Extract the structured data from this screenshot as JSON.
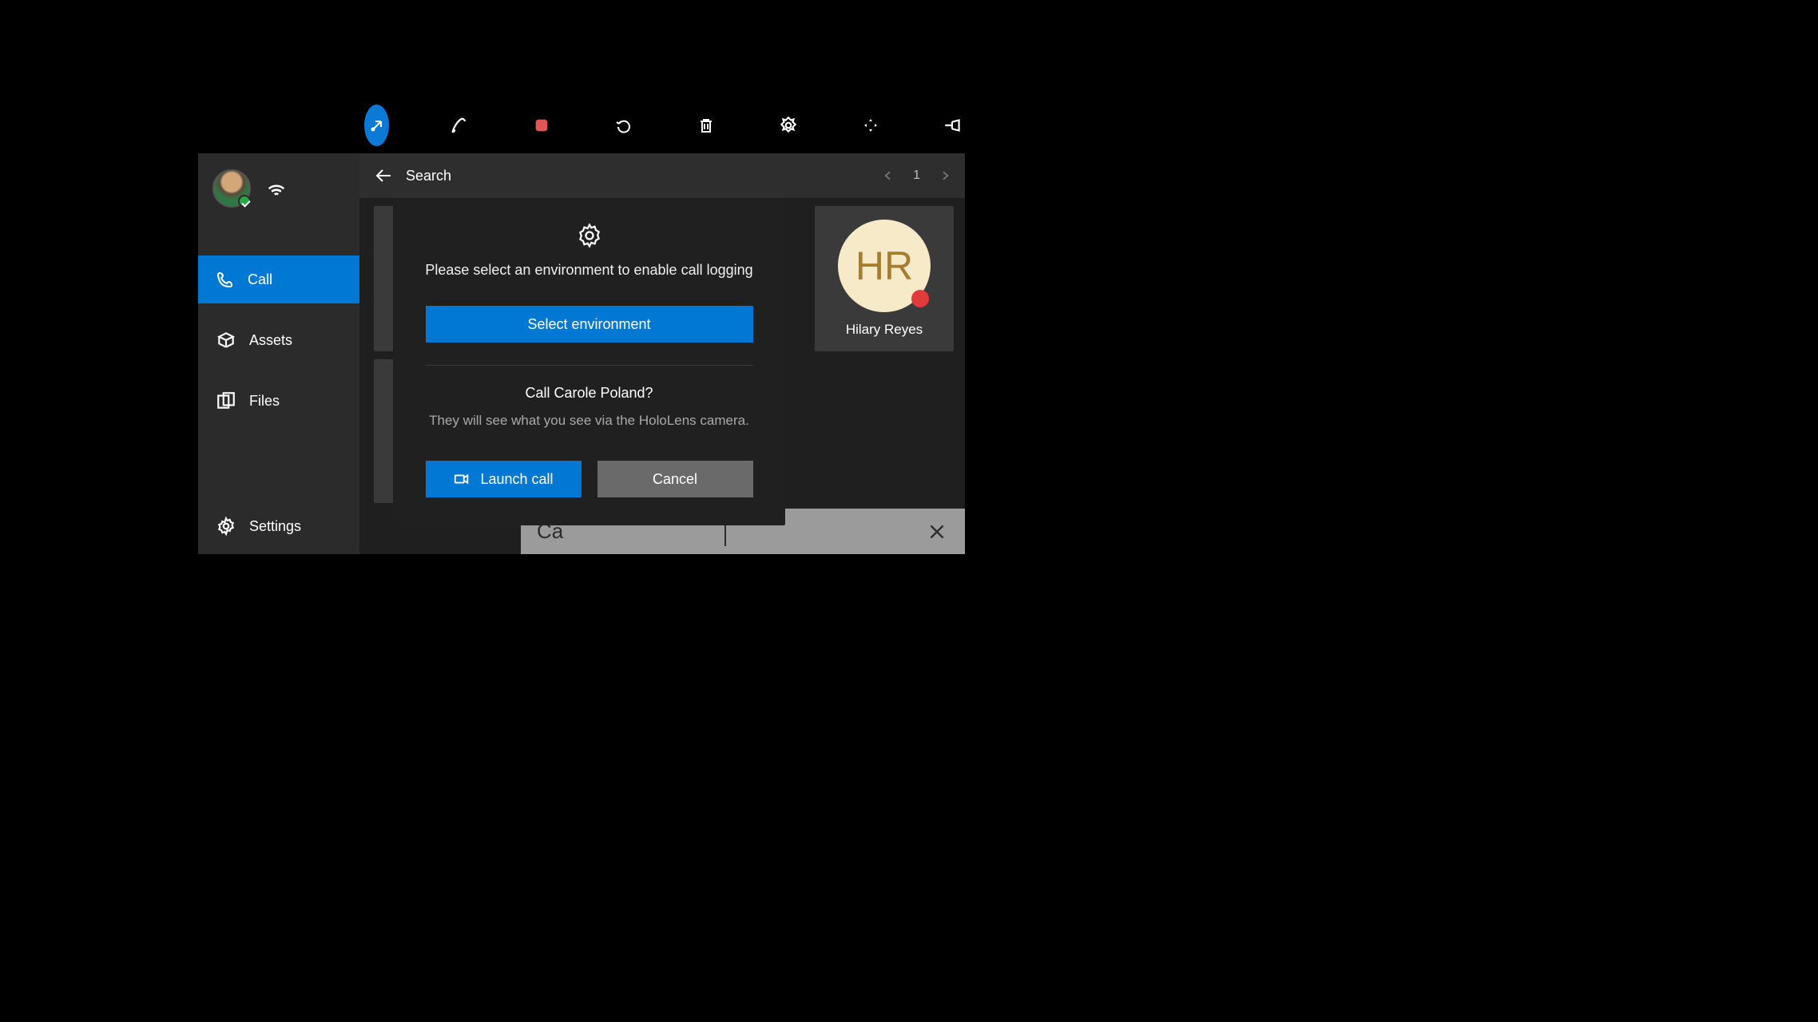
{
  "toolbar": {
    "icons": [
      "dock-icon",
      "pen-icon",
      "record-icon",
      "undo-icon",
      "trash-icon",
      "target-icon",
      "expand-icon",
      "pin-icon"
    ]
  },
  "sidebar": {
    "nav": {
      "call": "Call",
      "assets": "Assets",
      "files": "Files"
    },
    "settings": "Settings"
  },
  "header": {
    "title": "Search",
    "page": "1"
  },
  "contact": {
    "initials": "HR",
    "name": "Hilary Reyes"
  },
  "modal": {
    "env_msg": "Please select an environment to enable call logging",
    "select_btn": "Select environment",
    "call_q": "Call Carole Poland?",
    "call_sub": "They will see what you see via the HoloLens camera.",
    "launch": "Launch call",
    "cancel": "Cancel"
  },
  "search": {
    "value": "Ca"
  }
}
